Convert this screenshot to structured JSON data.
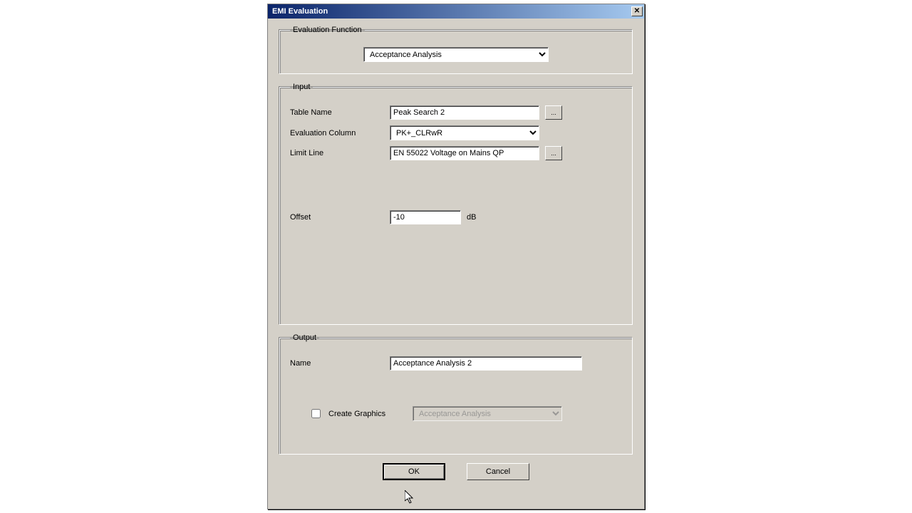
{
  "window": {
    "title": "EMI Evaluation"
  },
  "groups": {
    "eval_function": "Evaluation Function",
    "input": "Input",
    "output": "Output"
  },
  "eval": {
    "combo_value": "Acceptance Analysis"
  },
  "input": {
    "table_name_label": "Table Name",
    "table_name_value": "Peak Search 2",
    "browse_label": "...",
    "eval_column_label": "Evaluation Column",
    "eval_column_value": "PK+_CLRwR",
    "limit_line_label": "Limit Line",
    "limit_line_value": "EN 55022 Voltage on Mains QP",
    "offset_label": "Offset",
    "offset_value": "-10",
    "offset_unit": "dB"
  },
  "output": {
    "name_label": "Name",
    "name_value": "Acceptance Analysis 2",
    "create_graphics_label": "Create Graphics",
    "graphics_combo_value": "Acceptance Analysis"
  },
  "buttons": {
    "ok": "OK",
    "cancel": "Cancel"
  }
}
